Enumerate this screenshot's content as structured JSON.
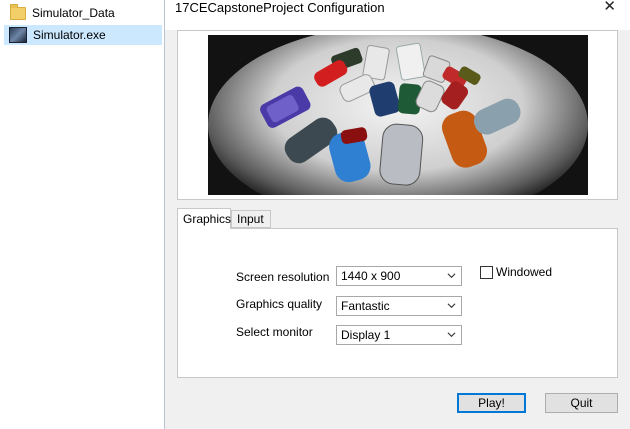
{
  "explorer": {
    "items": [
      {
        "label": "Simulator_Data",
        "icon": "folder-icon",
        "selected": false
      },
      {
        "label": "Simulator.exe",
        "icon": "app-icon",
        "selected": true
      }
    ]
  },
  "dialog": {
    "title": "17CECapstoneProject Configuration",
    "close_label": "✕",
    "tabs": [
      {
        "label": "Graphics",
        "active": true
      },
      {
        "label": "Input",
        "active": false
      }
    ],
    "settings": {
      "screen_resolution": {
        "label": "Screen resolution",
        "value": "1440 x 900"
      },
      "graphics_quality": {
        "label": "Graphics quality",
        "value": "Fantastic"
      },
      "select_monitor": {
        "label": "Select monitor",
        "value": "Display 1"
      },
      "windowed": {
        "label": "Windowed",
        "checked": false
      }
    },
    "buttons": {
      "play": "Play!",
      "quit": "Quit"
    }
  },
  "colors": {
    "selection": "#cce8ff",
    "focus_border": "#0078d7",
    "dialog_bg": "#f0f0f0"
  }
}
